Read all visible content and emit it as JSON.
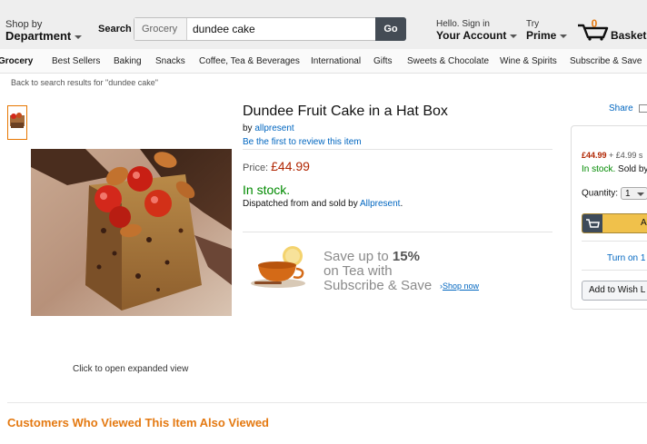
{
  "header": {
    "department_small": "Shop by",
    "department_big": "Department",
    "search_label": "Search",
    "search_category": "Grocery",
    "search_query": "dundee cake",
    "go_label": "Go",
    "account_small": "Hello. Sign in",
    "account_big": "Your Account",
    "prime_small": "Try",
    "prime_big": "Prime",
    "basket_count": "0",
    "basket_label": "Basket"
  },
  "nav": {
    "items": [
      "Grocery",
      "Best Sellers",
      "Baking",
      "Snacks",
      "Coffee, Tea & Beverages",
      "International",
      "Gifts",
      "Sweets & Chocolate",
      "Wine & Spirits",
      "Subscribe & Save"
    ]
  },
  "breadcrumb": {
    "back_link": "Back to search results for \"dundee cake\""
  },
  "gallery": {
    "expand_text": "Click to open expanded view"
  },
  "product": {
    "title": "Dundee Fruit Cake in a Hat Box",
    "by_prefix": "by",
    "brand": "allpresent",
    "review_link": "Be the first to review this item",
    "price_label": "Price:",
    "price": "£44.99",
    "stock": "In stock.",
    "dispatch_prefix": "Dispatched from and sold by",
    "seller": "Allpresent",
    "dispatch_suffix": "."
  },
  "promo": {
    "line1_prefix": "Save up to",
    "line1_percent": "15%",
    "line2": "on Tea with",
    "line3": "Subscribe & Save",
    "shop_now": "Shop now"
  },
  "buybox": {
    "share": "Share",
    "price": "£44.99",
    "shipping": "+ £4.99 s",
    "stock": "In stock.",
    "sold_by": "Sold by",
    "quantity_label": "Quantity:",
    "quantity_value": "1",
    "add_button": "Ad",
    "turn_on": "Turn on 1",
    "wish_list": "Add to Wish L"
  },
  "related": {
    "heading": "Customers Who Viewed This Item Also Viewed"
  },
  "colors": {
    "accent_orange": "#e47911",
    "link_blue": "#0066c0",
    "price_red": "#b12704",
    "stock_green": "#008a00",
    "button_yellow": "#f0c14b"
  }
}
